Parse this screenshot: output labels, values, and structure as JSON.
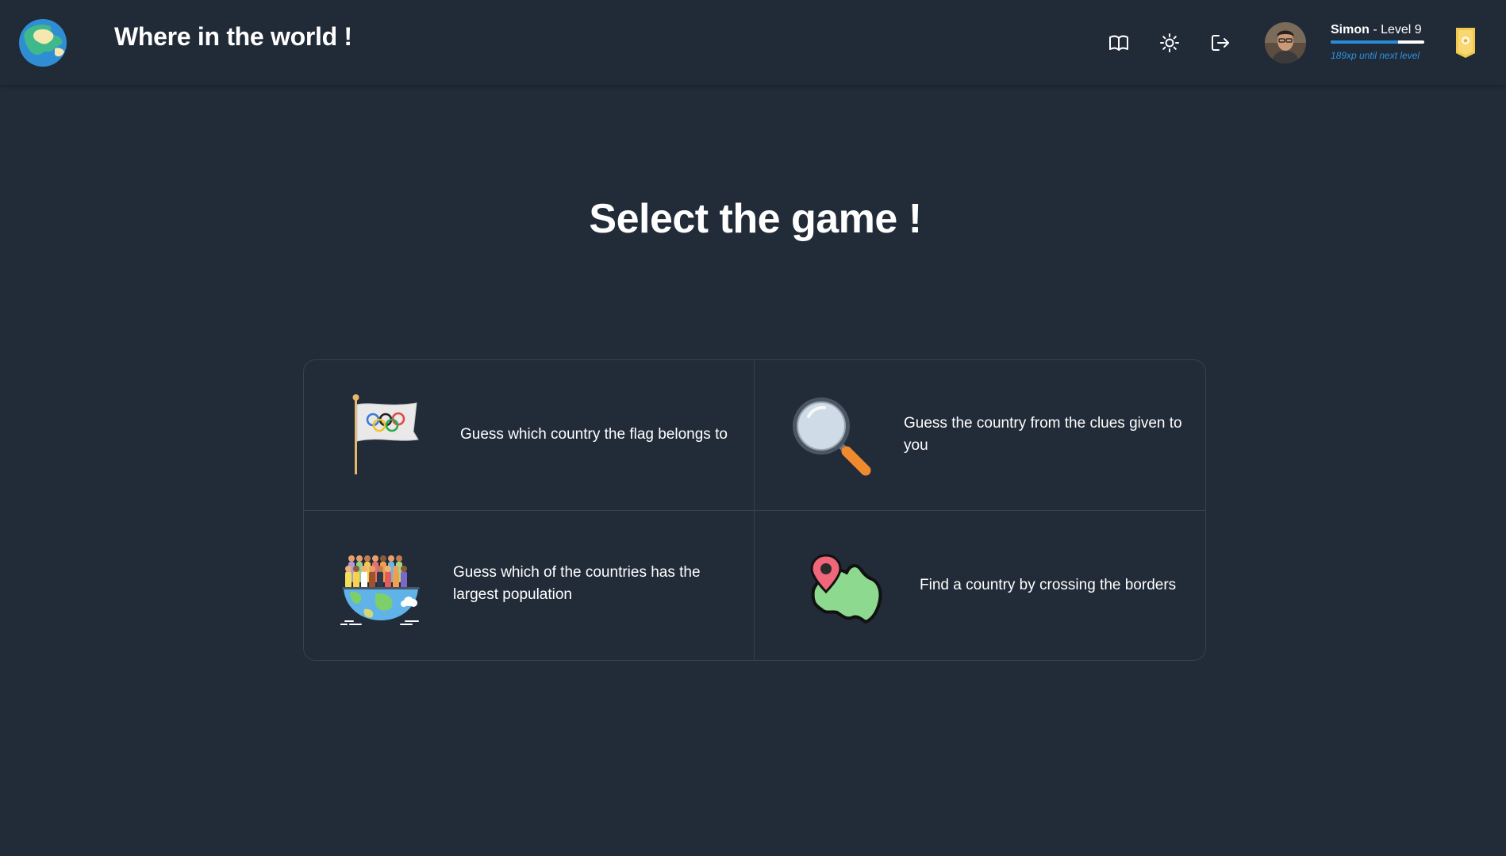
{
  "header": {
    "title": "Where in the world !",
    "user": {
      "name": "Simon",
      "separator": " - ",
      "level_label": "Level 9",
      "xp_progress_fraction": 0.72,
      "xp_text": "189xp until next level"
    }
  },
  "main": {
    "heading": "Select the game !",
    "games": [
      {
        "label": "Guess which country the flag belongs to",
        "icon": "olympic-flag-icon"
      },
      {
        "label": "Guess the country from the clues given to you",
        "icon": "magnifying-glass-icon"
      },
      {
        "label": "Guess which of the countries has the largest population",
        "icon": "population-globe-icon"
      },
      {
        "label": "Find a country by crossing the borders",
        "icon": "map-pin-country-icon"
      }
    ]
  },
  "colors": {
    "background": "#222b38",
    "header_background": "#212a37",
    "accent_blue": "#2a8bd8",
    "border": "#36414f"
  }
}
